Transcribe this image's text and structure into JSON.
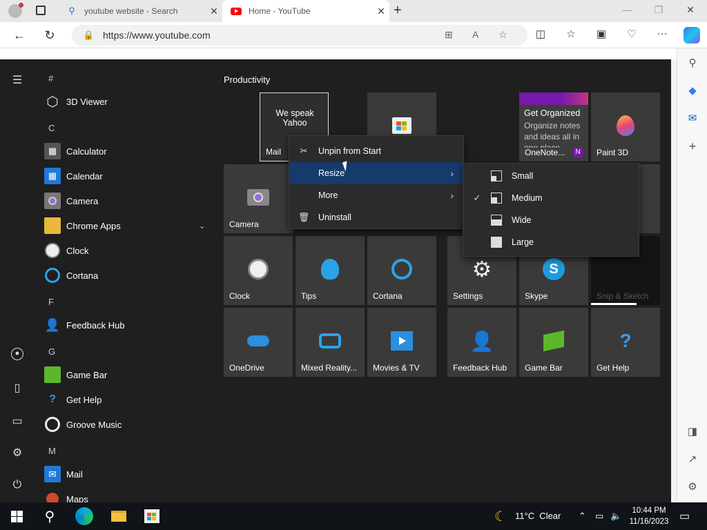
{
  "browser": {
    "tabs": [
      {
        "title": "youtube website - Search",
        "active": false
      },
      {
        "title": "Home - YouTube",
        "active": true
      }
    ],
    "url": "https://www.youtube.com",
    "new_tab": "+",
    "window_controls": [
      "—",
      "❐",
      "✕"
    ]
  },
  "start_menu": {
    "app_list": [
      {
        "type": "letter",
        "text": "#"
      },
      {
        "type": "app",
        "name": "3D Viewer",
        "icon": "cube-icon"
      },
      {
        "type": "letter",
        "text": "C"
      },
      {
        "type": "app",
        "name": "Calculator",
        "icon": "calculator-icon"
      },
      {
        "type": "app",
        "name": "Calendar",
        "icon": "calendar-icon"
      },
      {
        "type": "app",
        "name": "Camera",
        "icon": "camera-icon"
      },
      {
        "type": "app",
        "name": "Chrome Apps",
        "icon": "folder-icon",
        "expandable": true
      },
      {
        "type": "app",
        "name": "Clock",
        "icon": "clock-icon"
      },
      {
        "type": "app",
        "name": "Cortana",
        "icon": "cortana-icon"
      },
      {
        "type": "letter",
        "text": "F"
      },
      {
        "type": "app",
        "name": "Feedback Hub",
        "icon": "feedback-icon"
      },
      {
        "type": "letter",
        "text": "G"
      },
      {
        "type": "app",
        "name": "Game Bar",
        "icon": "gamebar-icon"
      },
      {
        "type": "app",
        "name": "Get Help",
        "icon": "help-icon"
      },
      {
        "type": "app",
        "name": "Groove Music",
        "icon": "groove-icon"
      },
      {
        "type": "letter",
        "text": "M"
      },
      {
        "type": "app",
        "name": "Mail",
        "icon": "mail-icon"
      },
      {
        "type": "app",
        "name": "Maps",
        "icon": "maps-icon"
      }
    ],
    "group_title": "Productivity",
    "tiles": {
      "mail": {
        "top_text": "We speak Yahoo",
        "label": "Mail"
      },
      "onenote": {
        "heading": "Get Organized",
        "body": "Organize notes and ideas all in one place",
        "label": "OneNote..."
      },
      "paint3d": "Paint 3D",
      "camera": "Camera",
      "clock": "Clock",
      "tips": "Tips",
      "cortana": "Cortana",
      "settings": "Settings",
      "skype": "Skype",
      "snip": "Snip & Sketch",
      "onedrive": "OneDrive",
      "mixed_reality": "Mixed Reality...",
      "movies": "Movies & TV",
      "feedback": "Feedback Hub",
      "gamebar": "Game Bar",
      "gethelp": "Get Help"
    },
    "context_menu": {
      "unpin": "Unpin from Start",
      "resize": "Resize",
      "more": "More",
      "uninstall": "Uninstall"
    },
    "resize_menu": {
      "small": "Small",
      "medium": "Medium",
      "wide": "Wide",
      "large": "Large",
      "selected": "Medium"
    }
  },
  "taskbar": {
    "weather": "11°C  Clear",
    "time": "10:44 PM",
    "date": "11/16/2023"
  }
}
